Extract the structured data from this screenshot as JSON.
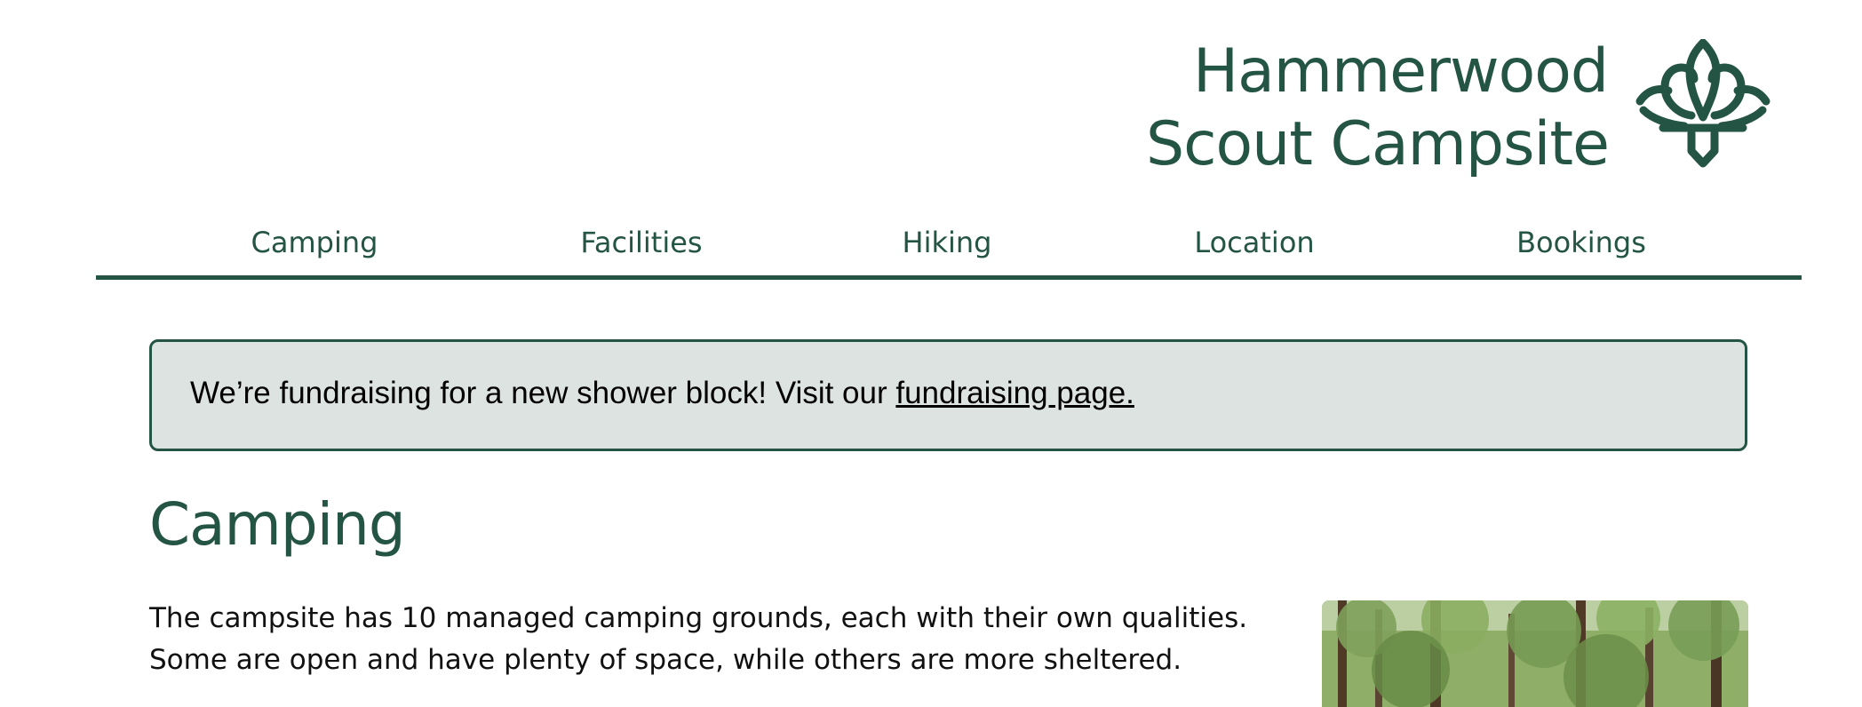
{
  "header": {
    "title_line1": "Hammerwood",
    "title_line2": "Scout Campsite",
    "logo_icon": "fleur-de-lis-icon"
  },
  "nav": {
    "items": [
      {
        "label": "Camping"
      },
      {
        "label": "Facilities"
      },
      {
        "label": "Hiking"
      },
      {
        "label": "Location"
      },
      {
        "label": "Bookings"
      }
    ]
  },
  "banner": {
    "text": "We’re fundraising for a new shower block! Visit our ",
    "link_text": "fundraising page."
  },
  "main": {
    "heading": "Camping",
    "intro_line1": "The campsite has 10 managed camping grounds, each with their own qualities.",
    "intro_line2": "Some are open and have plenty of space, while others are more sheltered."
  },
  "colors": {
    "brand": "#245443",
    "banner_bg": "#dce3e0",
    "text": "#111111"
  }
}
